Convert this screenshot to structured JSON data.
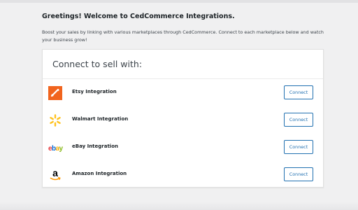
{
  "header": {
    "greeting": "Greetings! Welcome to CedCommerce Integrations.",
    "intro": "Boost your sales by linking with various marketplaces through CedCommerce. Connect to each marketplace below and watch your business grow!"
  },
  "card": {
    "title": "Connect to sell with:",
    "integrations": [
      {
        "name": "Etsy Integration",
        "button": "Connect",
        "icon": "etsy-logo-icon",
        "color": "#f1641e"
      },
      {
        "name": "Walmart Integration",
        "button": "Connect",
        "icon": "walmart-spark-icon",
        "color": "#ffc220"
      },
      {
        "name": "eBay Integration",
        "button": "Connect",
        "icon": "ebay-logo-icon",
        "color": "#e53238"
      },
      {
        "name": "Amazon Integration",
        "button": "Connect",
        "icon": "amazon-logo-icon",
        "color": "#ff9900"
      }
    ]
  },
  "colors": {
    "accent": "#2271b1",
    "background": "#f0f0f1"
  }
}
